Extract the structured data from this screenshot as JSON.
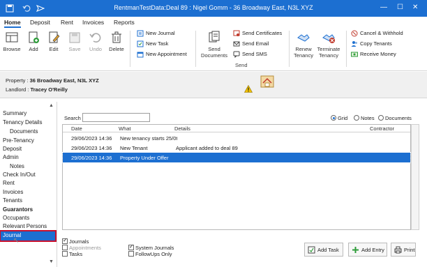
{
  "window": {
    "title": "RentmanTestData:Deal 89 : Nigel Gomm - 36 Broadway East, N3L XYZ"
  },
  "ribbon_tabs": [
    "Home",
    "Deposit",
    "Rent",
    "Invoices",
    "Reports"
  ],
  "ribbon": {
    "browse": "Browse",
    "add": "Add",
    "edit": "Edit",
    "save": "Save",
    "undo": "Undo",
    "delete": "Delete",
    "new_journal": "New Journal",
    "new_task": "New Task",
    "new_appointment": "New Appointment",
    "send_documents_1": "Send",
    "send_documents_2": "Documents",
    "send_certificates": "Send Certificates",
    "send_email": "Send Email",
    "send_sms": "Send SMS",
    "send_group": "Send",
    "renew_1": "Renew",
    "renew_2": "Tenancy",
    "terminate_1": "Terminate",
    "terminate_2": "Tenancy",
    "cancel_withhold": "Cancel & Withhold",
    "copy_tenants": "Copy Tenants",
    "receive_money": "Receive Money"
  },
  "info": {
    "property_label": "Property :",
    "property_value": "36 Broadway East, N3L XYZ",
    "landlord_label": "Landlord :",
    "landlord_value": "Tracey O'Reilly"
  },
  "nav": {
    "items": [
      {
        "label": "Summary"
      },
      {
        "label": "Tenancy Details"
      },
      {
        "label": "Documents"
      },
      {
        "label": "Pre-Tenancy"
      },
      {
        "label": "Deposit"
      },
      {
        "label": "Admin"
      },
      {
        "label": "Notes"
      },
      {
        "label": "Check In/Out"
      },
      {
        "label": "Rent"
      },
      {
        "label": "Invoices"
      },
      {
        "label": "Tenants"
      },
      {
        "label": "Guarantors"
      },
      {
        "label": "Occupants"
      },
      {
        "label": "Relevant Persons"
      },
      {
        "label": "Journal"
      }
    ]
  },
  "main": {
    "search_label": "Search :",
    "search_value": "",
    "view_options": [
      "Grid",
      "Notes",
      "Documents"
    ],
    "selected_view": "Grid",
    "columns": [
      "Date",
      "What",
      "Details",
      "Contractor"
    ],
    "rows": [
      {
        "date": "29/06/2023 14:36",
        "what": "New tenancy starts 25/0t",
        "details": "",
        "contractor": ""
      },
      {
        "date": "29/06/2023 14:36",
        "what": "New Tenant",
        "details": "Applicant added to deal 89",
        "contractor": ""
      },
      {
        "date": "29/06/2023 14:36",
        "what": "Property Under Offer",
        "details": "",
        "contractor": ""
      }
    ]
  },
  "footer": {
    "journals": "Journals",
    "appointments": "Appointments",
    "tasks": "Tasks",
    "system_journals": "System Journals",
    "followups_only": "FollowUps Only",
    "add_task": "Add Task",
    "add_entry": "Add Entry",
    "print": "Print"
  },
  "colors": {
    "accent": "#1c6fd1",
    "highlight_border": "#c8102e"
  }
}
